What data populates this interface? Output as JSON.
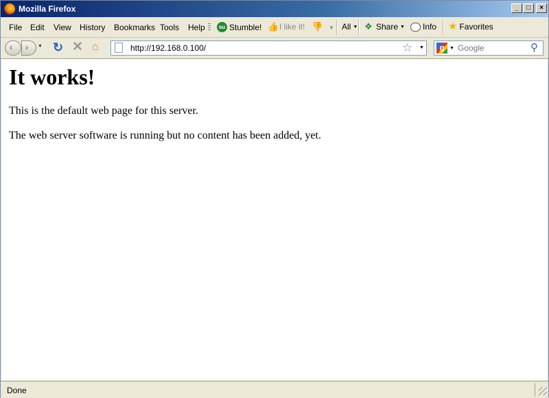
{
  "window": {
    "title": "Mozilla Firefox"
  },
  "menu": {
    "items": [
      {
        "label": "File"
      },
      {
        "label": "Edit"
      },
      {
        "label": "View"
      },
      {
        "label": "History"
      },
      {
        "label": "Bookmarks"
      },
      {
        "label": "Tools"
      },
      {
        "label": "Help"
      }
    ],
    "toolbar": {
      "stumble_label": "Stumble!",
      "ilike_label": "I like it!",
      "all_label": "All",
      "share_label": "Share",
      "info_label": "Info",
      "favorites_label": "Favorites"
    }
  },
  "nav": {
    "url": "http://192.168.0.100/",
    "search_placeholder": "Google"
  },
  "page": {
    "heading": "It works!",
    "p1": "This is the default web page for this server.",
    "p2": "The web server software is running but no content has been added, yet."
  },
  "status": {
    "text": "Done"
  },
  "icons": {
    "title": "firefox-icon",
    "back": "back-arrow-icon",
    "forward": "forward-arrow-icon",
    "reload": "reload-icon",
    "stop": "stop-icon",
    "home": "home-icon",
    "bookmark": "star-icon",
    "search": "magnifier-icon"
  },
  "colors": {
    "titlebar_start": "#0a246a",
    "titlebar_end": "#a6caf0",
    "chrome": "#ece9d8",
    "reload": "#1f63c9"
  }
}
